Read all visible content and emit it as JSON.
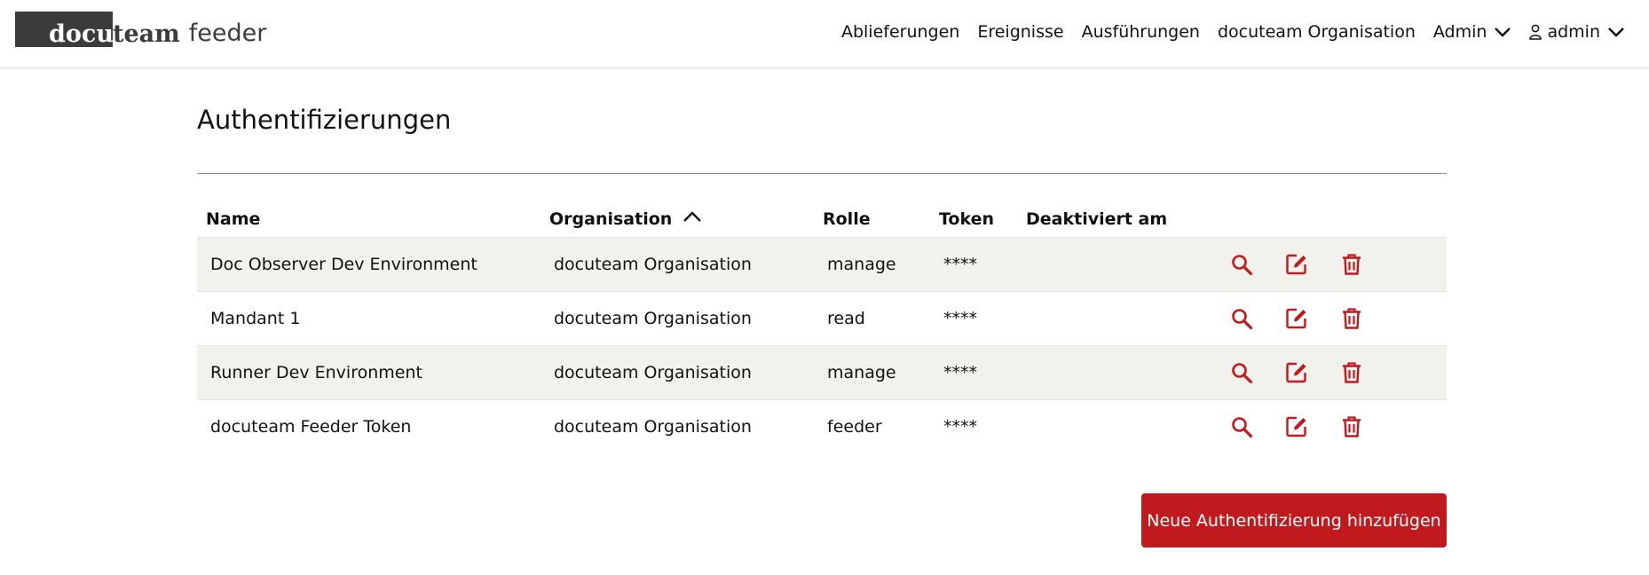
{
  "app": {
    "logo_part1": "docu",
    "logo_part2": "team",
    "logo_part3": "feeder"
  },
  "nav": {
    "items": [
      "Ablieferungen",
      "Ereignisse",
      "Ausführungen",
      "docuteam Organisation"
    ],
    "admin_menu": "Admin",
    "user_menu": "admin"
  },
  "page": {
    "title": "Authentifizierungen"
  },
  "table": {
    "headers": {
      "name": "Name",
      "organisation": "Organisation",
      "rolle": "Rolle",
      "token": "Token",
      "deaktiviert": "Deaktiviert am"
    },
    "sort_column": "organisation",
    "sort_direction": "ascending",
    "rows": [
      {
        "name": "Doc Observer Dev Environment",
        "organisation": "docuteam Organisation",
        "rolle": "manage",
        "token": "****",
        "deaktiviert": ""
      },
      {
        "name": "Mandant 1",
        "organisation": "docuteam Organisation",
        "rolle": "read",
        "token": "****",
        "deaktiviert": ""
      },
      {
        "name": "Runner Dev Environment",
        "organisation": "docuteam Organisation",
        "rolle": "manage",
        "token": "****",
        "deaktiviert": ""
      },
      {
        "name": "docuteam Feeder Token",
        "organisation": "docuteam Organisation",
        "rolle": "feeder",
        "token": "****",
        "deaktiviert": ""
      }
    ],
    "row_actions": [
      "search-icon",
      "edit-icon",
      "trash-icon"
    ]
  },
  "actions": {
    "add_label": "Neue Authentifizierung hinzufügen"
  },
  "colors": {
    "accent": "#c01a1f",
    "logo_dark": "#3b3b3b",
    "row_stripe": "#f2f2ed"
  }
}
